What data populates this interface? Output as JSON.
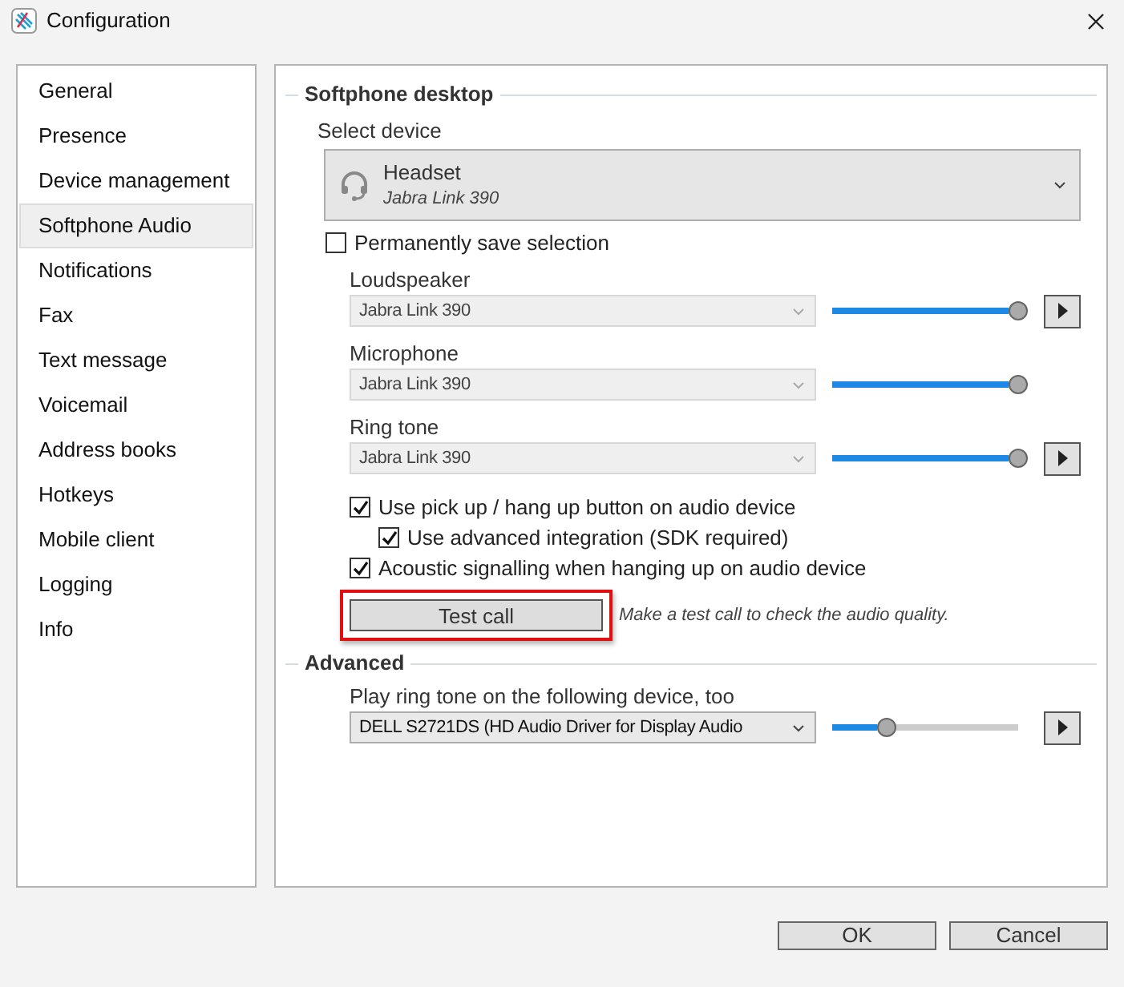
{
  "window": {
    "title": "Configuration"
  },
  "sidebar": {
    "items": [
      {
        "label": "General",
        "selected": false
      },
      {
        "label": "Presence",
        "selected": false
      },
      {
        "label": "Device management",
        "selected": false
      },
      {
        "label": "Softphone Audio",
        "selected": true
      },
      {
        "label": "Notifications",
        "selected": false
      },
      {
        "label": "Fax",
        "selected": false
      },
      {
        "label": "Text message",
        "selected": false
      },
      {
        "label": "Voicemail",
        "selected": false
      },
      {
        "label": "Address books",
        "selected": false
      },
      {
        "label": "Hotkeys",
        "selected": false
      },
      {
        "label": "Mobile client",
        "selected": false
      },
      {
        "label": "Logging",
        "selected": false
      },
      {
        "label": "Info",
        "selected": false
      }
    ]
  },
  "softphone_desktop": {
    "title": "Softphone desktop",
    "select_device_label": "Select device",
    "device": {
      "name": "Headset",
      "model": "Jabra Link 390"
    },
    "permanent_save": {
      "label": "Permanently save selection",
      "checked": false
    },
    "channels": [
      {
        "label": "Loudspeaker",
        "value": "Jabra Link 390",
        "disabled": true,
        "level": 1.0,
        "play_button": true
      },
      {
        "label": "Microphone",
        "value": "Jabra Link 390",
        "disabled": true,
        "level": 1.0,
        "play_button": false
      },
      {
        "label": "Ring tone",
        "value": "Jabra Link 390",
        "disabled": true,
        "level": 1.0,
        "play_button": true
      }
    ],
    "options": [
      {
        "label": "Use pick up / hang up button on audio device",
        "checked": true,
        "children": [
          {
            "label": "Use advanced integration (SDK required)",
            "checked": true
          }
        ]
      },
      {
        "label": "Acoustic signalling when hanging up on audio device",
        "checked": true
      }
    ],
    "test_call": {
      "label": "Test call",
      "highlighted": true,
      "hint": "Make a test call to check the audio quality."
    }
  },
  "advanced": {
    "title": "Advanced",
    "channels": [
      {
        "label": "Play ring tone on the following device, too",
        "value": "DELL S2721DS (HD Audio Driver for Display Audio",
        "disabled": false,
        "level": 0.25,
        "play_button": true
      }
    ]
  },
  "buttons": [
    "OK",
    "Cancel"
  ]
}
